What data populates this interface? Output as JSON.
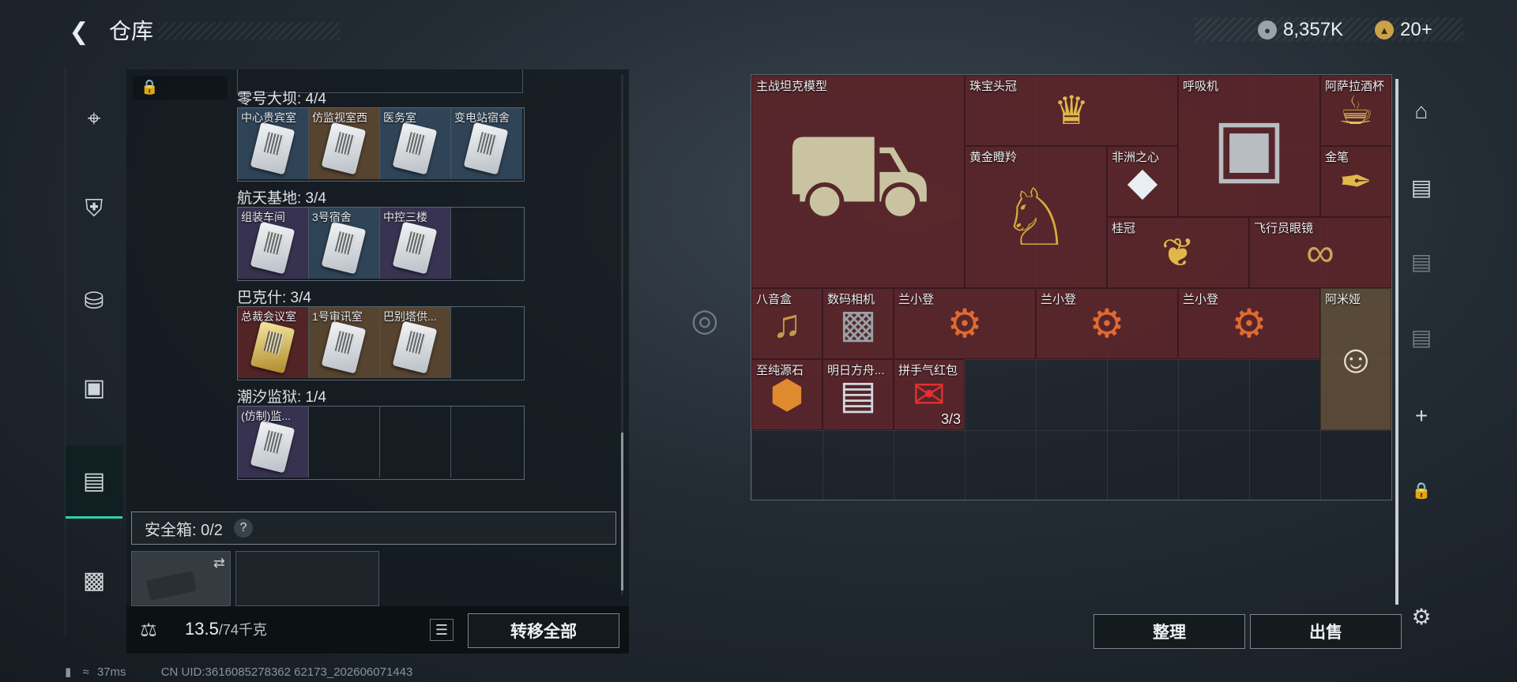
{
  "header": {
    "title": "仓库",
    "currency_amount": "8,357K",
    "token_amount": "20+"
  },
  "left_nav": {
    "icons": [
      "pistol-icon",
      "armor-icon",
      "backpack-icon",
      "chest-rig-icon",
      "container-icon",
      "toolbox-icon"
    ]
  },
  "collections": [
    {
      "label": "零号大坝: 4/4",
      "items": [
        {
          "name": "中心贵宾室",
          "bg": "bg-blue",
          "gold": false
        },
        {
          "name": "仿监视室西",
          "bg": "bg-gold",
          "gold": false
        },
        {
          "name": "医务室",
          "bg": "bg-blue",
          "gold": false
        },
        {
          "name": "变电站宿舍",
          "bg": "bg-blue",
          "gold": false
        }
      ]
    },
    {
      "label": "航天基地: 3/4",
      "items": [
        {
          "name": "组装车间",
          "bg": "bg-purple",
          "gold": false
        },
        {
          "name": "3号宿舍",
          "bg": "bg-blue",
          "gold": false
        },
        {
          "name": "中控三楼",
          "bg": "bg-purple",
          "gold": false
        }
      ]
    },
    {
      "label": "巴克什: 3/4",
      "items": [
        {
          "name": "总裁会议室",
          "bg": "bg-red",
          "gold": true
        },
        {
          "name": "1号审讯室",
          "bg": "bg-gold",
          "gold": false
        },
        {
          "name": "巴别塔供...",
          "bg": "bg-gold",
          "gold": false
        }
      ]
    },
    {
      "label": "潮汐监狱: 1/4",
      "items": [
        {
          "name": "(仿制)监...",
          "bg": "bg-purple",
          "gold": false
        }
      ]
    }
  ],
  "safebox": {
    "label": "安全箱: 0/2",
    "help": "?"
  },
  "bottom": {
    "weight": "13.5",
    "weight_max": "/74千克",
    "transfer_all": "转移全部"
  },
  "right_items": [
    {
      "name": "主战坦克模型",
      "col": 0,
      "row": 0,
      "w": 3,
      "h": 3,
      "icon": "tank-model-icon"
    },
    {
      "name": "珠宝头冠",
      "col": 3,
      "row": 0,
      "w": 3,
      "h": 1,
      "icon": "jeweled-crown-icon"
    },
    {
      "name": "呼吸机",
      "col": 6,
      "row": 0,
      "w": 2,
      "h": 2,
      "icon": "ventilator-icon"
    },
    {
      "name": "阿萨拉酒杯",
      "col": 8,
      "row": 0,
      "w": 1,
      "h": 1,
      "icon": "goblet-icon"
    },
    {
      "name": "黄金瞪羚",
      "col": 3,
      "row": 1,
      "w": 2,
      "h": 2,
      "icon": "golden-gazelle-icon"
    },
    {
      "name": "非洲之心",
      "col": 5,
      "row": 1,
      "w": 1,
      "h": 1,
      "icon": "diamond-icon"
    },
    {
      "name": "金笔",
      "col": 8,
      "row": 1,
      "w": 1,
      "h": 1,
      "icon": "gold-pen-icon"
    },
    {
      "name": "桂冠",
      "col": 5,
      "row": 2,
      "w": 2,
      "h": 1,
      "icon": "laurel-crown-icon"
    },
    {
      "name": "飞行员眼镜",
      "col": 7,
      "row": 2,
      "w": 2,
      "h": 1,
      "icon": "aviator-glasses-icon"
    },
    {
      "name": "八音盒",
      "col": 0,
      "row": 3,
      "w": 1,
      "h": 1,
      "icon": "music-box-icon"
    },
    {
      "name": "数码相机",
      "col": 1,
      "row": 3,
      "w": 1,
      "h": 1,
      "icon": "camera-icon"
    },
    {
      "name": "兰小登",
      "col": 2,
      "row": 3,
      "w": 2,
      "h": 1,
      "icon": "robot-toy-icon"
    },
    {
      "name": "兰小登",
      "col": 4,
      "row": 3,
      "w": 2,
      "h": 1,
      "icon": "robot-toy-icon"
    },
    {
      "name": "兰小登",
      "col": 6,
      "row": 3,
      "w": 2,
      "h": 1,
      "icon": "robot-toy-icon"
    },
    {
      "name": "阿米娅",
      "col": 8,
      "row": 3,
      "w": 1,
      "h": 2,
      "icon": "figurine-icon"
    },
    {
      "name": "至纯源石",
      "col": 0,
      "row": 4,
      "w": 1,
      "h": 1,
      "icon": "originium-icon"
    },
    {
      "name": "明日方舟...",
      "col": 1,
      "row": 4,
      "w": 1,
      "h": 1,
      "icon": "album-icon"
    },
    {
      "name": "拼手气红包",
      "col": 2,
      "row": 4,
      "w": 1,
      "h": 1,
      "icon": "red-envelope-icon",
      "count": "3/3"
    }
  ],
  "right_buttons": {
    "sort": "整理",
    "sell": "出售"
  },
  "status": {
    "ping": "37ms",
    "uid": "CN UID:3616085278362 62173_202606071443"
  }
}
